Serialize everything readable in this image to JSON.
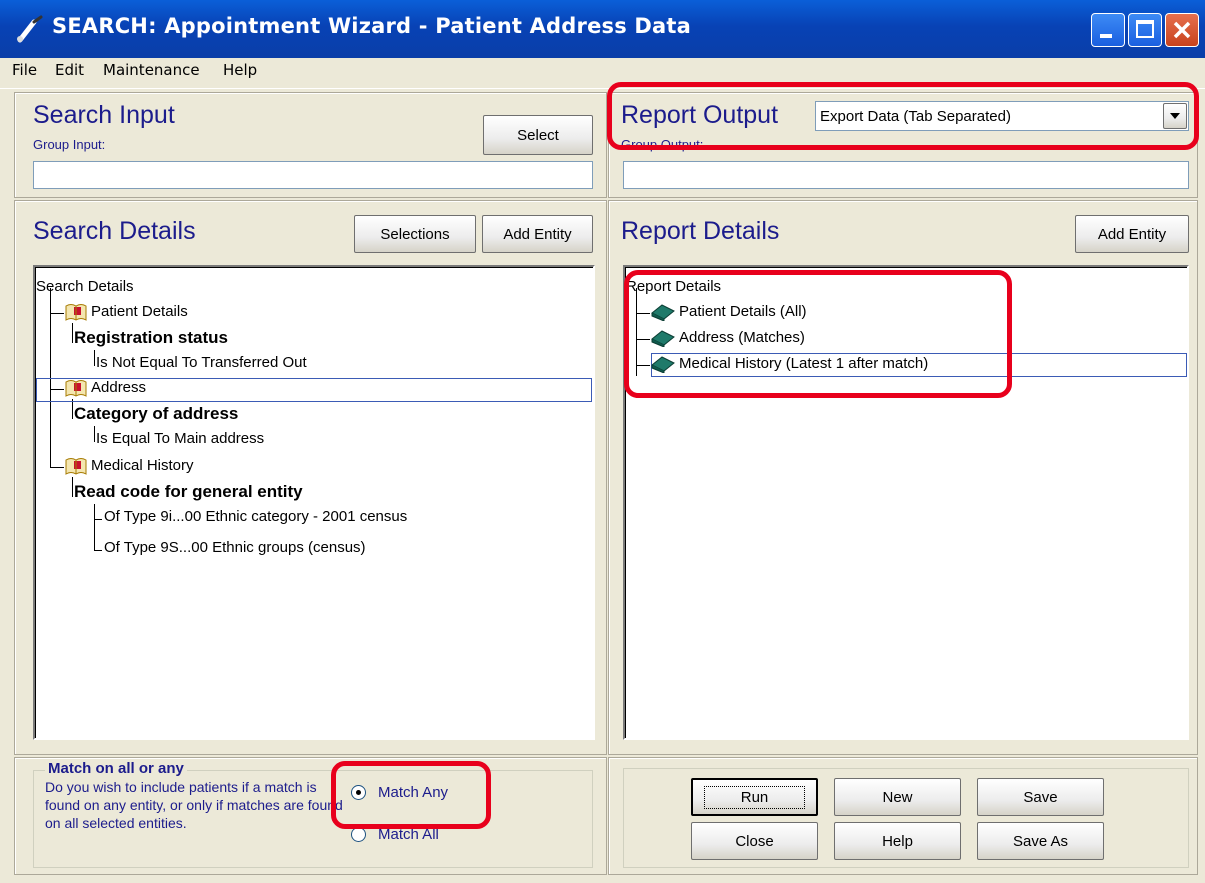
{
  "window": {
    "title": "SEARCH: Appointment Wizard - Patient Address Data"
  },
  "menu": [
    {
      "label": "File"
    },
    {
      "label": "Edit"
    },
    {
      "label": "Maintenance"
    },
    {
      "label": "Help"
    }
  ],
  "search_input": {
    "heading": "Search Input",
    "sublabel": "Group Input:",
    "select_label": "Select",
    "value": ""
  },
  "report_output": {
    "heading": "Report Output",
    "dropdown_value": "Export Data (Tab Separated)",
    "sublabel": "Group Output:",
    "value": ""
  },
  "search_details": {
    "heading": "Search Details",
    "selections_label": "Selections",
    "add_entity_label": "Add Entity",
    "tree": {
      "root": "Search Details",
      "nodes": [
        "Patient Details",
        "Registration status",
        "Is Not Equal To Transferred Out",
        "Address",
        "Category of address",
        "Is Equal To Main address",
        "Medical History",
        "Read code for general entity",
        "Of Type 9i...00 Ethnic category - 2001 census",
        "Of Type 9S...00 Ethnic groups (census)"
      ]
    }
  },
  "report_details": {
    "heading": "Report Details",
    "add_entity_label": "Add Entity",
    "tree": {
      "root": "Report Details",
      "nodes": [
        "Patient Details (All)",
        "Address (Matches)",
        "Medical History (Latest 1 after match)"
      ]
    }
  },
  "match": {
    "heading": "Match on all or any",
    "description": "Do you wish to include patients if a match is found on any entity, or only if matches are found on all selected entities.",
    "options": [
      "Match Any",
      "Match All"
    ],
    "selected": "Match Any"
  },
  "actions": {
    "run": "Run",
    "new": "New",
    "save": "Save",
    "close": "Close",
    "help": "Help",
    "save_as": "Save As"
  },
  "colors": {
    "titlebar": "#0a4fc8",
    "heading": "#1c1c8c",
    "highlight": "#e8001c",
    "face": "#ece9d8"
  }
}
